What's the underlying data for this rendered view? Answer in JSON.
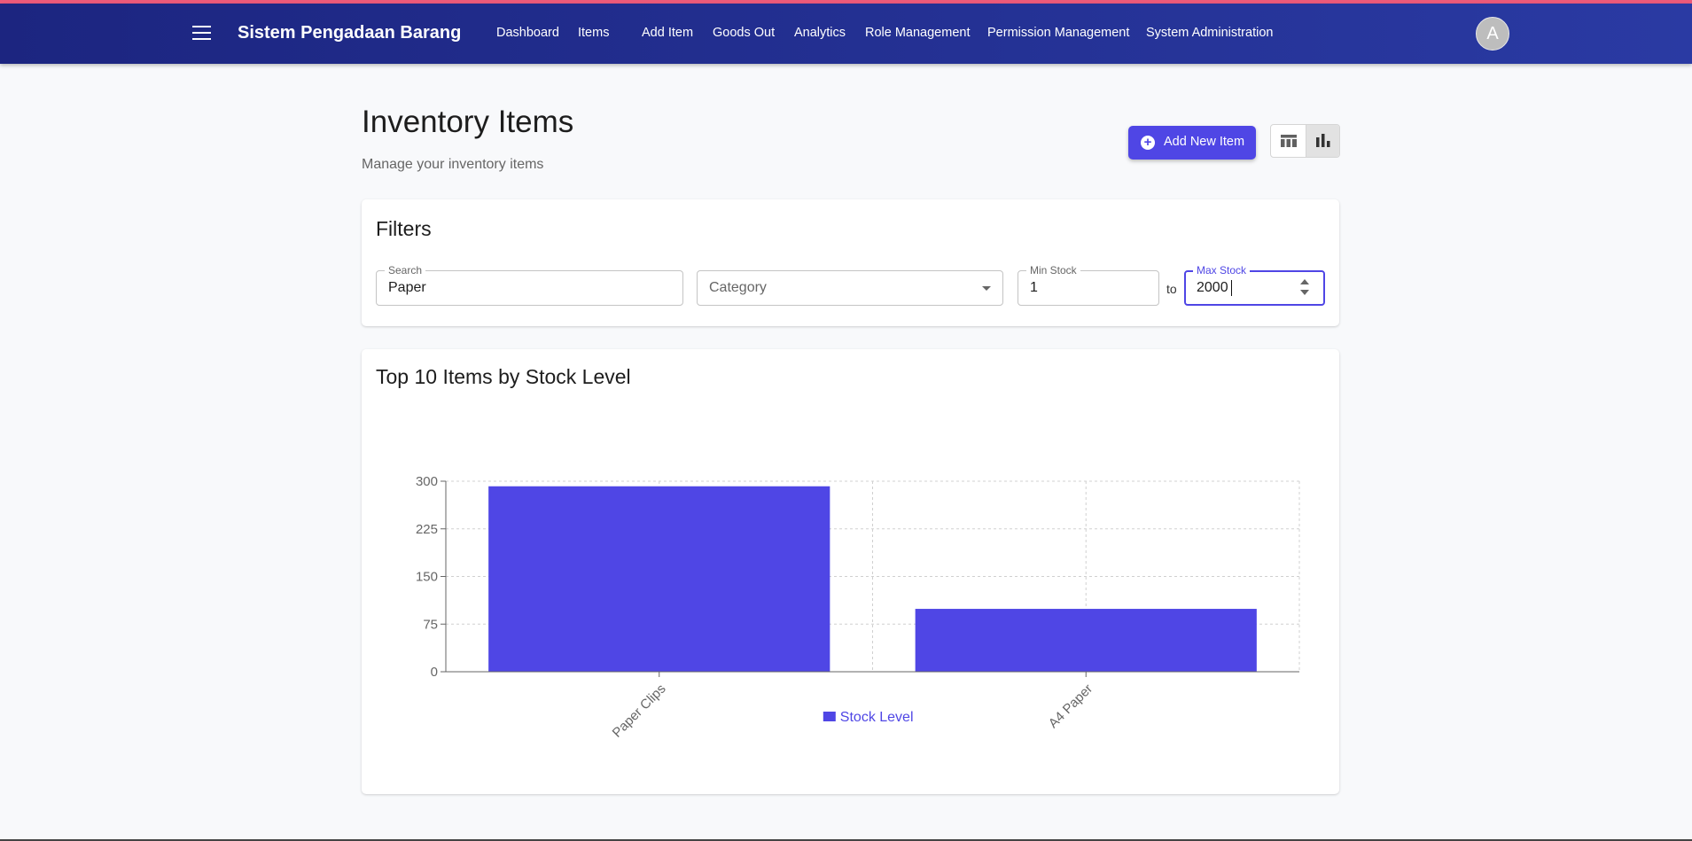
{
  "appbar": {
    "brand": "Sistem Pengadaan Barang",
    "nav": [
      "Dashboard",
      "Items",
      "Add Item",
      "Goods Out",
      "Analytics",
      "Role Management",
      "Permission Management",
      "System Administration"
    ],
    "avatar_initial": "A"
  },
  "page": {
    "title": "Inventory Items",
    "subtitle": "Manage your inventory items",
    "add_button": "Add New Item",
    "view_toggle": {
      "options": [
        "table-view",
        "chart-view"
      ],
      "selected": "chart-view"
    }
  },
  "filters": {
    "title": "Filters",
    "search": {
      "label": "Search",
      "value": "Paper"
    },
    "category": {
      "placeholder": "Category"
    },
    "min_stock": {
      "label": "Min Stock",
      "value": "1"
    },
    "range_separator": "to",
    "max_stock": {
      "label": "Max Stock",
      "value": "2000"
    }
  },
  "colors": {
    "accent": "#4f46e5",
    "appbar": "#1c2580",
    "topline": "#ec5a7a"
  },
  "chart_data": {
    "type": "bar",
    "title": "Top 10 Items by Stock Level",
    "categories": [
      "Paper Clips",
      "A4 Paper"
    ],
    "series": [
      {
        "name": "Stock Level",
        "values": [
          292,
          99
        ]
      }
    ],
    "yticks": [
      0,
      75,
      150,
      225,
      300
    ],
    "ylim": [
      0,
      300
    ],
    "grid": true,
    "legend": "bottom-center",
    "color": "#4f46e5"
  }
}
